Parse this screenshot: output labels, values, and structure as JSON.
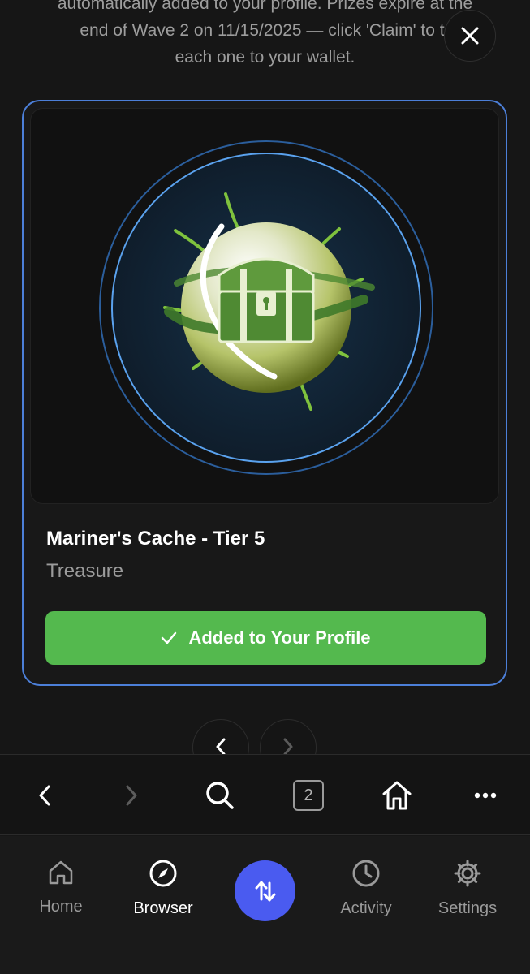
{
  "intro": {
    "line1": "automatically added to your profile. Prizes expire at the",
    "line2": "end of Wave 2 on 11/15/2025 — click 'Claim' to tr",
    "line3": "each one to your wallet."
  },
  "card": {
    "item_title": "Mariner's Cache - Tier 5",
    "item_type": "Treasure",
    "button_label": "Added to Your Profile",
    "button_icon": "check-icon"
  },
  "toolbar": {
    "tab_count": "2"
  },
  "bottom_nav": {
    "items": [
      {
        "label": "Home",
        "icon": "home-icon"
      },
      {
        "label": "Browser",
        "icon": "compass-icon"
      },
      {
        "label": "Activity",
        "icon": "clock-icon"
      },
      {
        "label": "Settings",
        "icon": "gear-icon"
      }
    ],
    "active": "Browser",
    "fab_icon": "swap-arrows-icon"
  },
  "colors": {
    "accent_green": "#54b94e",
    "card_border": "#4c7fd8",
    "fab_blue": "#4a5bf0"
  }
}
